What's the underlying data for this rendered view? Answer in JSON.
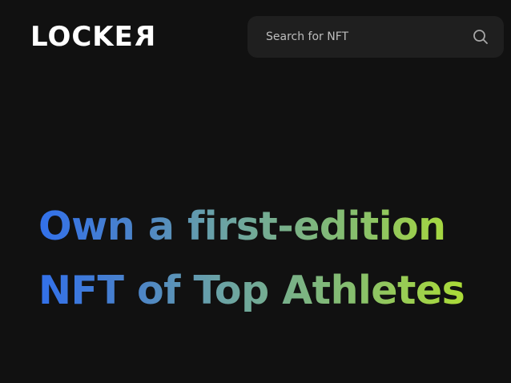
{
  "header": {
    "logo": {
      "text_left": "LOCKE",
      "text_mirrored": "R"
    },
    "search": {
      "placeholder": "Search for NFT",
      "icon": "search-icon"
    }
  },
  "hero": {
    "line1": "Own a first-edition",
    "line2": "NFT of Top Athletes",
    "gradient_colors": [
      "#3270ea",
      "#4c84c8",
      "#6aa2a6",
      "#86be6e",
      "#b4e22c"
    ]
  },
  "colors": {
    "background": "#111111",
    "search_background": "#1f1f1f",
    "logo": "#ffffff"
  }
}
